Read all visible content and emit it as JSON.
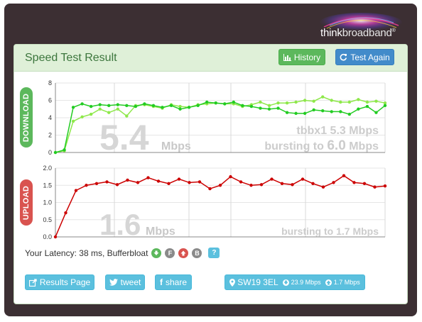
{
  "logo": {
    "part1": "think",
    "part2": "broadband",
    "mark": "®"
  },
  "panel": {
    "title": "Speed Test Result"
  },
  "header_buttons": {
    "history": "History",
    "test_again": "Test Again"
  },
  "download": {
    "label": "DOWNLOAD",
    "big_value": "5.4",
    "unit": "Mbps",
    "reference": "tbbx1 5.3 Mbps",
    "bursting_prefix": "bursting to",
    "bursting_value": "6.0",
    "bursting_unit": "Mbps",
    "color": "#5cb85c"
  },
  "upload": {
    "label": "UPLOAD",
    "big_value": "1.6",
    "unit": "Mbps",
    "bursting": "bursting to 1.7 Mbps",
    "color": "#d9534f"
  },
  "latency": {
    "text": "Your Latency: 38 ms, Bufferbloat",
    "badge_f1": "F",
    "badge_f2": "B",
    "help": "?"
  },
  "footer_buttons": {
    "results_page": "Results Page",
    "tweet": "tweet",
    "share": "share",
    "location": "SW19 3EL",
    "loc_down": "23.9 Mbps",
    "loc_up": "1.7 Mbps"
  },
  "chart_data": [
    {
      "type": "line",
      "ylim": [
        0,
        8
      ],
      "yticks": [
        "0",
        "2",
        "4",
        "6",
        "8"
      ],
      "grid": true,
      "series": [
        {
          "color": "#8ee84a",
          "values": [
            0,
            0.2,
            3.6,
            4.1,
            4.4,
            5.0,
            4.6,
            5.0,
            4.2,
            5.4,
            5.5,
            5.3,
            5.1,
            5.5,
            5.3,
            5.2,
            5.5,
            5.6,
            5.7,
            5.6,
            5.6,
            5.3,
            5.5,
            5.8,
            5.4,
            5.7,
            5.7,
            5.8,
            6.0,
            5.9,
            6.4,
            6.0,
            5.8,
            5.8,
            6.1,
            5.8,
            5.9,
            5.7
          ]
        },
        {
          "color": "#22cc22",
          "values": [
            0,
            0.3,
            5.2,
            5.6,
            5.3,
            5.5,
            5.4,
            5.5,
            5.4,
            5.3,
            5.6,
            5.4,
            5.2,
            5.4,
            5.0,
            5.2,
            5.4,
            5.8,
            5.7,
            5.6,
            5.8,
            5.4,
            5.3,
            5.1,
            5.0,
            5.1,
            4.6,
            4.5,
            4.5,
            4.9,
            4.8,
            4.7,
            4.7,
            4.4,
            5.0,
            5.3,
            4.6,
            5.4
          ]
        }
      ]
    },
    {
      "type": "line",
      "ylim": [
        0,
        2.0
      ],
      "yticks": [
        "0.0",
        "0.5",
        "1.0",
        "1.5",
        "2.0"
      ],
      "grid": true,
      "series": [
        {
          "color": "#cc0000",
          "values": [
            0,
            0.7,
            1.35,
            1.5,
            1.55,
            1.6,
            1.52,
            1.65,
            1.58,
            1.72,
            1.62,
            1.55,
            1.68,
            1.58,
            1.6,
            1.4,
            1.5,
            1.75,
            1.6,
            1.5,
            1.52,
            1.68,
            1.55,
            1.52,
            1.68,
            1.55,
            1.45,
            1.58,
            1.78,
            1.58,
            1.55,
            1.45,
            1.48
          ]
        }
      ]
    }
  ]
}
